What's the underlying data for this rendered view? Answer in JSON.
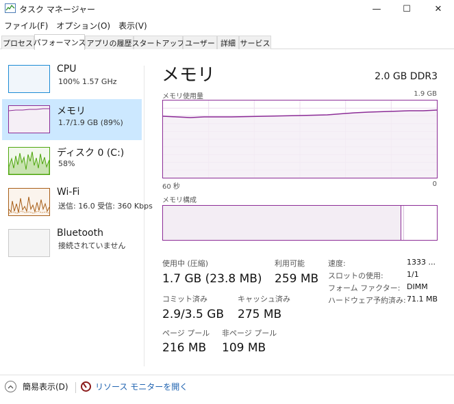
{
  "window": {
    "title": "タスク マネージャー",
    "minimize_glyph": "—",
    "maximize_glyph": "☐",
    "close_glyph": "✕"
  },
  "menu": [
    "ファイル(F)",
    "オプション(O)",
    "表示(V)"
  ],
  "tabs": [
    "プロセス",
    "パフォーマンス",
    "アプリの履歴",
    "スタートアップ",
    "ユーザー",
    "詳細",
    "サービス"
  ],
  "active_tab": "パフォーマンス",
  "sidebar": {
    "items": [
      {
        "name": "CPU",
        "detail": "100%  1.57 GHz",
        "color": "#1a8ad4"
      },
      {
        "name": "メモリ",
        "detail": "1.7/1.9 GB (89%)",
        "color": "#8b2b96"
      },
      {
        "name": "ディスク 0 (C:)",
        "detail": "58%",
        "color": "#4da60c"
      },
      {
        "name": "Wi-Fi",
        "detail": "送信: 16.0  受信: 360 Kbps",
        "color": "#a75d16"
      },
      {
        "name": "Bluetooth",
        "detail": "接続されていません",
        "color": "#bbbbbb"
      }
    ]
  },
  "main": {
    "title": "メモリ",
    "spec": "2.0 GB DDR3",
    "usage_graph_label": "メモリ使用量",
    "usage_graph_max": "1.9 GB",
    "axis_left": "60 秒",
    "axis_right": "0",
    "composition_label": "メモリ構成",
    "usage_fraction": 0.89,
    "in_use_fraction_of_bar": 0.87,
    "accent_color": "#8b2b96"
  },
  "stats": {
    "in_use_label": "使用中 (圧縮)",
    "in_use_value": "1.7 GB (23.8 MB)",
    "available_label": "利用可能",
    "available_value": "259 MB",
    "committed_label": "コミット済み",
    "committed_value": "2.9/3.5 GB",
    "cached_label": "キャッシュ済み",
    "cached_value": "275 MB",
    "paged_label": "ページ プール",
    "paged_value": "216 MB",
    "nonpaged_label": "非ページ プール",
    "nonpaged_value": "109 MB"
  },
  "details": [
    {
      "label": "速度:",
      "value": "1333 ..."
    },
    {
      "label": "スロットの使用:",
      "value": "1/1"
    },
    {
      "label": "フォーム ファクター:",
      "value": "DIMM"
    },
    {
      "label": "ハードウェア予約済み:",
      "value": "71.1 MB"
    }
  ],
  "footer": {
    "simple_view": "簡易表示(D)",
    "resource_monitor": "リソース モニターを開く",
    "link_color": "#1e62b0"
  }
}
